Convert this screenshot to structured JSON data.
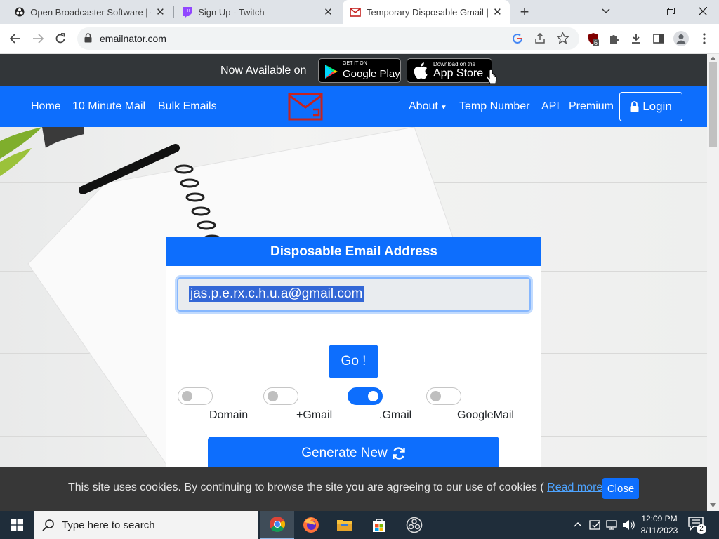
{
  "browser": {
    "tabs": [
      {
        "title": "Open Broadcaster Software | OBS",
        "active": false
      },
      {
        "title": "Sign Up - Twitch",
        "active": false
      },
      {
        "title": "Temporary Disposable Gmail | Te",
        "active": true
      }
    ],
    "new_tab": "+",
    "url": "emailnator.com",
    "extension_badge": "6"
  },
  "site": {
    "banner_text": "Now Available on",
    "google_play": {
      "small": "GET IT ON",
      "big": "Google Play"
    },
    "app_store": {
      "small": "Download on the",
      "big": "App Store"
    },
    "nav_left": [
      "Home",
      "10 Minute Mail",
      "Bulk Emails"
    ],
    "nav_right": {
      "about": "About",
      "temp_number": "Temp Number",
      "api": "API",
      "premium": "Premium",
      "login": "Login"
    },
    "card": {
      "title": "Disposable Email Address",
      "email": "jas.p.e.rx.c.h.u.a@gmail.com",
      "go": "Go !",
      "toggles": [
        {
          "label": "Domain",
          "on": false
        },
        {
          "label": "+Gmail",
          "on": false
        },
        {
          "label": ".Gmail",
          "on": true
        },
        {
          "label": "GoogleMail",
          "on": false
        }
      ],
      "generate": "Generate New"
    },
    "cookie": {
      "text_before": "This site uses cookies. By continuing to browse the site you are agreeing to our use of cookies (",
      "read_more": "Read more",
      "text_after": ")",
      "close": "Close"
    }
  },
  "taskbar": {
    "search_placeholder": "Type here to search",
    "time": "12:09 PM",
    "date": "8/11/2023",
    "notification_count": "2"
  },
  "colors": {
    "primary": "#0d6efd",
    "banner": "#323639",
    "taskbar": "#1f2d3a"
  }
}
